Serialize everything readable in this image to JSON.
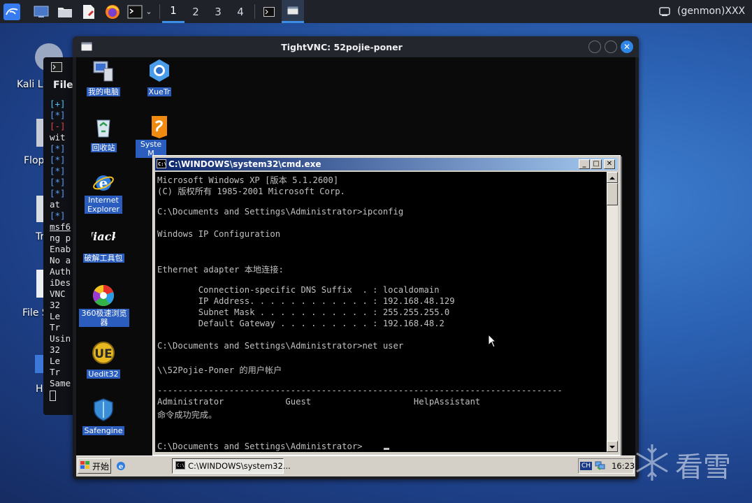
{
  "top_panel": {
    "workspaces": [
      "1",
      "2",
      "3",
      "4"
    ],
    "active_workspace": "1",
    "genmon_label": "(genmon)XXX"
  },
  "kali_desktop": {
    "icons": [
      "Kali Li",
      "Flop",
      "Tr",
      "File S",
      "H"
    ]
  },
  "bg_terminal": {
    "menu_file": "File",
    "lines": [
      "[+]",
      "[*]",
      "[-]",
      " wit",
      "[*]",
      "[*]",
      "[*]",
      "[*]",
      "[*]",
      " at",
      "[*]",
      "msf6",
      "ng p",
      "Enab",
      "No a",
      "Auth",
      "iDes",
      "VNC",
      "  32",
      "  Le",
      "  Tr",
      "Usin",
      "  32",
      "  Le",
      "  Tr",
      "Same"
    ]
  },
  "vnc_window": {
    "title": "TightVNC: 52pojie-poner"
  },
  "xp_desktop": {
    "icons": [
      {
        "label": "我的电脑",
        "icon": "my-computer-icon"
      },
      {
        "label": "XueTr",
        "icon": "xuetr-icon"
      },
      {
        "label": "回收站",
        "icon": "recycle-bin-icon"
      },
      {
        "label": "Syste M",
        "icon": "system-tool-icon"
      },
      {
        "label": "Internet Explorer",
        "icon": "internet-explorer-icon"
      },
      {
        "label": "破解工具包",
        "icon": "crack-toolkit-icon"
      },
      {
        "label": "360极速浏览器",
        "icon": "360-browser-icon"
      },
      {
        "label": "Uedit32",
        "icon": "uedit32-icon"
      },
      {
        "label": "Safengine",
        "icon": "safengine-icon"
      }
    ]
  },
  "cmd_window": {
    "title": "C:\\WINDOWS\\system32\\cmd.exe",
    "lines": [
      "Microsoft Windows XP [版本 5.1.2600]",
      "(C) 版权所有 1985-2001 Microsoft Corp.",
      "",
      "C:\\Documents and Settings\\Administrator>ipconfig",
      "",
      "Windows IP Configuration",
      "",
      "",
      "Ethernet adapter 本地连接:",
      "",
      "        Connection-specific DNS Suffix  . : localdomain",
      "        IP Address. . . . . . . . . . . . : 192.168.48.129",
      "        Subnet Mask . . . . . . . . . . . : 255.255.255.0",
      "        Default Gateway . . . . . . . . . : 192.168.48.2",
      "",
      "C:\\Documents and Settings\\Administrator>net user",
      "",
      "\\\\52Pojie-Poner 的用户帐户",
      "",
      "-------------------------------------------------------------------------------",
      "Administrator            Guest                    HelpAssistant",
      "命令成功完成。",
      "",
      "",
      "C:\\Documents and Settings\\Administrator>"
    ]
  },
  "xp_taskbar": {
    "start_label": "开始",
    "task_label": "C:\\WINDOWS\\system32...",
    "ime_label": "CH",
    "clock": "16:23"
  },
  "watermark": {
    "text": "看雪"
  },
  "colors": {
    "panel_bg": "#1f2229",
    "accent": "#3c8de6",
    "xp_title_start": "#0a246a",
    "xp_title_end": "#a6caf0",
    "xp_face": "#d4d0c8"
  }
}
